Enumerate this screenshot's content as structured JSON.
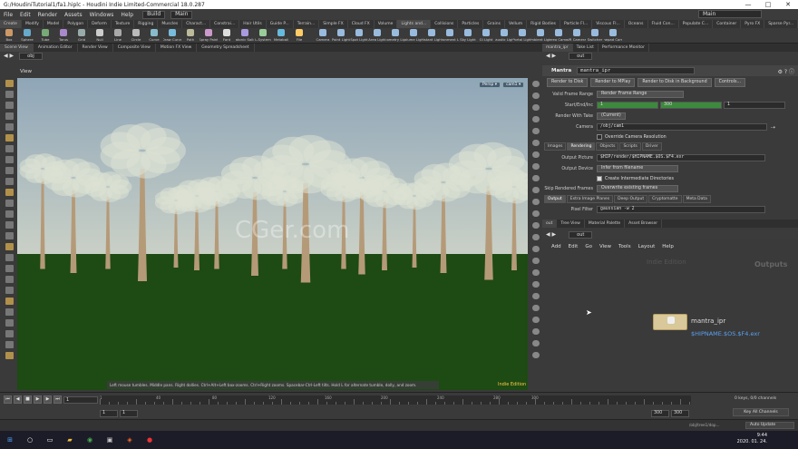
{
  "window": {
    "title": "G:/HoudiniTutorial1/fa1.hiplc - Houdini Indie Limited-Commercial 18.0.287",
    "controls": [
      "—",
      "□",
      "✕"
    ]
  },
  "menubar": {
    "items": [
      "File",
      "Edit",
      "Render",
      "Assets",
      "Windows",
      "Help"
    ],
    "desktop_left": "Build",
    "desktop_mid": "Main",
    "desktop_right": "Main"
  },
  "shelf_tabs": [
    "Create",
    "Modify",
    "Model",
    "Polygon",
    "Deform",
    "Texture",
    "Rigging",
    "Muscles",
    "Charact...",
    "Constrai...",
    "Hair Utils",
    "Guide P...",
    "Terrain...",
    "Simple FX",
    "Cloud FX",
    "Volume",
    "Lights and...",
    "Collisions",
    "Particles",
    "Grains",
    "Vellum",
    "Rigid Bodies",
    "Particle Fl...",
    "Viscous Fl...",
    "Oceans",
    "Fluid Con...",
    "Populate C...",
    "Container",
    "Pyro FX",
    "Sparse Pyr...",
    "FEM",
    "Wires",
    "Crowds",
    "Drive Sim"
  ],
  "shelf_tools": [
    "Box",
    "Sphere",
    "Tube",
    "Torus",
    "Grid",
    "Null",
    "Line",
    "Circle",
    "Curve",
    "Draw Curve",
    "Path",
    "Spray Paint",
    "Font",
    "Platonic Solids",
    "L-System",
    "Metaball",
    "File"
  ],
  "light_tools": [
    "Camera",
    "Point Light",
    "Spot Light",
    "Area Light",
    "Geometry Light",
    "Volume Light",
    "Distant Light",
    "Environment Light",
    "Sky Light",
    "GI Light",
    "Caustic Light",
    "Portal Light",
    "Ambient Light",
    "Stereo Camera",
    "VR Camera",
    "Switcher",
    "Gamepad Camera"
  ],
  "left_tabs": [
    "Scene View",
    "Animation Editor",
    "Render View",
    "Composite View",
    "Motion FX View",
    "Geometry Spreadsheet"
  ],
  "left_path": "obj",
  "viewport": {
    "label": "View",
    "persp": "Persp ▾",
    "cam": "cam1 ▾",
    "hint": "Left mouse tumbles. Middle pans. Right dollies. Ctrl+Alt+Left box-zooms. Ctrl+Right zooms. Spacebar-Ctrl-Left tilts. Hold L for alternate tumble, dolly, and zoom.",
    "edition": "Indie Edition",
    "watermark": "CGer.com",
    "sky_top": "#8fa6b8",
    "sky_bottom": "#c9d0c6",
    "ground": "#1e4a14"
  },
  "timeline": {
    "frame": "1",
    "ticks": [
      "1",
      "40",
      "80",
      "120",
      "160",
      "200",
      "240",
      "280",
      "300"
    ],
    "start": "1",
    "start2": "1",
    "end": "300",
    "end2": "300",
    "keys": "0 keys, 0/0 channels",
    "key_all": "Key All Channels"
  },
  "status": {
    "path": "/obj/tree1/dop...",
    "auto": "Auto Update"
  },
  "taskbar": {
    "time": "9:44",
    "date": "2020. 01. 24."
  },
  "right_tabs": [
    "mantra_ipr",
    "Take List",
    "Performance Monitor"
  ],
  "right_path": "out",
  "params": {
    "node_type": "Mantra",
    "node_name": "mantra_ipr",
    "buttons": [
      "Render to Disk",
      "Render to MPlay",
      "Render to Disk in Background",
      "Controls..."
    ],
    "valid_frame_range_label": "Valid Frame Range",
    "valid_frame_range": "Render Frame Range",
    "start_end_label": "Start/End/Inc",
    "start": "1",
    "end": "300",
    "inc": "1",
    "take_label": "Render With Take",
    "take": "(Current)",
    "camera_label": "Camera",
    "camera": "/obj/cam1",
    "override_label": "Override Camera Resolution",
    "tabs": [
      "Images",
      "Rendering",
      "Objects",
      "Scripts",
      "Driver"
    ],
    "output_picture_label": "Output Picture",
    "output_picture": "$HIP/render/$HIPNAME.$OS.$F4.exr",
    "output_device_label": "Output Device",
    "output_device": "Infer from filename",
    "create_dirs_label": "Create Intermediate Directories",
    "skip_label": "Skip Rendered Frames",
    "skip": "Overwrite existing frames",
    "subtabs": [
      "Output",
      "Extra Image Planes",
      "Deep Output",
      "Cryptomatte",
      "Meta Data"
    ],
    "pixel_filter_label": "Pixel Filter",
    "pixel_filter": "gaussian -w 2"
  },
  "net_tabs": [
    "out",
    "Tree View",
    "Material Palette",
    "Asset Browser"
  ],
  "net_path": "out",
  "net_menu": [
    "Add",
    "Edit",
    "Go",
    "View",
    "Tools",
    "Layout",
    "Help"
  ],
  "net": {
    "edition": "Indie Edition",
    "outputs": "Outputs",
    "node_name": "mantra_ipr",
    "node_sub": "$HIPNAME.$OS.$F4.exr"
  }
}
